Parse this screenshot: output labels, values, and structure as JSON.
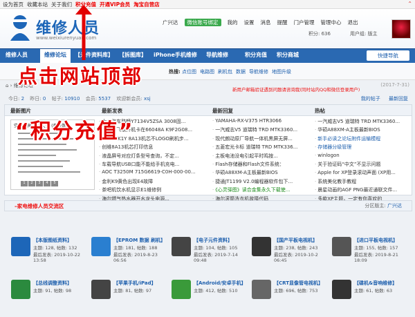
{
  "topbar": {
    "links": [
      "设为首页",
      "收藏本站",
      "关于我们",
      "积分充值",
      "开通VIP会员",
      "淘宝自营店"
    ],
    "red_links": [
      false,
      false,
      false,
      true,
      true,
      true
    ]
  },
  "header": {
    "logo_title": "维修人员",
    "logo_url": "www.weixiurenyuan.com",
    "user_links": [
      "广兴达",
      "微信账号绑定",
      "我的",
      "设置",
      "消息",
      "提醒",
      "门户管理",
      "管理中心",
      "退出"
    ],
    "points": "积分: 636",
    "group": "用户组: 版主"
  },
  "nav": {
    "items": [
      "维修人员",
      "维修论坛",
      "【元件资料库】",
      "【拆图库】",
      "iPhone手机维修",
      "导航维修",
      "积分充值",
      "积分商城"
    ],
    "active_index": 1,
    "quick": "快捷导航"
  },
  "hot": {
    "label": "热搜:",
    "items": [
      "点位图",
      "电路图",
      "刷机包",
      "数据",
      "导航维修",
      "地图升级"
    ]
  },
  "overlays": {
    "line1": "点击网站顶部",
    "line2": "“积分充值”"
  },
  "breadcrumb": {
    "path": "维修论坛",
    "date": "(2017-7-31)",
    "notice": "新用户邮箱验证遇到问题请咨询我(同时站内QQ和微信登录用户)"
  },
  "stats": {
    "prefix": "今日:",
    "today": "2",
    "yesterday_label": "昨日:",
    "yesterday": "0",
    "threads_label": "帖子:",
    "threads": "10910",
    "members_label": "会员:",
    "members": "5537",
    "new_member_label": "欢迎新会员:",
    "new_member": "xsj",
    "links": [
      "我的帖子",
      "最新回复"
    ]
  },
  "panel": {
    "heads": [
      "最新图片",
      "最新发表",
      "最新回复",
      "热帖"
    ],
    "thumb_title": "空调故障代码大全 (奥克斯)",
    "thumb_pages": [
      "1",
      "2",
      "3",
      "4",
      "5"
    ],
    "col2": [
      "大众汽车路畅Y7134V5ZSA 3008固...",
      "汉兰达飞歌开机卡在66048A K9F2G08...",
      "创维42K1Y 8A13机芯不LOGO刷机步...",
      "创维8A13机芯打印信息",
      "液晶屏号对应灯条型号查询，不定...",
      "车载导航USB口能不能给手机充电...",
      "AOC T3250M 715G6619-C0H-000-00...",
      "金利K9黄色出现E4故障",
      "茶吧机饮水机显示E1维修例",
      "海尔燃气热水器开水龙头电源..."
    ],
    "col3": [
      "YAMAHA-RX-V375 HTR3066",
      "一汽威志V5 道瑞特 TRD MTK3360...",
      "现代朗动原厂导航一体机黑屏无屏...",
      "五菱宏光卡标 道瑞特 TRD MTK336...",
      "主板电池没电引起平时鸣按...",
      "Flash存储器和Flash文件系统：",
      "华硕A88XM-A主板最新BIOS",
      "捷通JT1199 V2.0编程器软件包下...",
      "《心灵驿图》读合金集永久下载使...",
      "海尔滚筒洗衣机故障代码"
    ],
    "col4": [
      "一汽威志V5 道瑞特 TRD MTK3360...",
      "华硕A88XM-A主板最新BIOS",
      "新手必读之论坛附件运输模程",
      "存储器分级管理",
      "winlogon",
      "关于验证码“中文”不显示问题",
      "Apple for XP登录滚动声面 (XP用...",
      "系统美化教手教程",
      "晨星动画的AGF PNG最近通联文件...",
      "多款XP主题，一定有你喜欢的"
    ],
    "col3_hl": [
      false,
      false,
      false,
      false,
      false,
      false,
      false,
      false,
      true,
      false
    ],
    "col4_hl": [
      false,
      false,
      true,
      true,
      false,
      false,
      false,
      false,
      false,
      false
    ]
  },
  "section": {
    "title": "家电维修人员交流区",
    "mod_label": "分区版主:",
    "mod": "广兴达"
  },
  "forums": [
    {
      "name": "【本版图纸资料】",
      "stats": "主题: 128, 帖数: 132",
      "last": "最后发表: 2019-10-22",
      "time": "13:58"
    },
    {
      "name": "【EPROM 数据 刷机】",
      "stats": "主题: 181, 帖数: 188",
      "last": "最后发表: 2019-8-23",
      "time": "06:56"
    },
    {
      "name": "【电子元件资料】",
      "stats": "主题: 104, 帖数: 105",
      "last": "最后发表: 2019-7-14",
      "time": "09:48"
    },
    {
      "name": "【国产平板电视机】",
      "stats": "主题: 238, 帖数: 243",
      "last": "最后发表: 2019-10-2",
      "time": "06:45"
    },
    {
      "name": "【进口平板电视机】",
      "stats": "主题: 155, 帖数: 157",
      "last": "最后发表: 2019-8-21",
      "time": "18:09"
    },
    {
      "name": "【总线调整资料】",
      "stats": "主题: 91, 帖数: 98",
      "last": "",
      "time": ""
    },
    {
      "name": "【苹果手机/iPad】",
      "stats": "主题: 81, 帖数: 97",
      "last": "",
      "time": ""
    },
    {
      "name": "【Android/安卓手机】",
      "stats": "主题: 412, 帖数: 510",
      "last": "",
      "time": ""
    },
    {
      "name": "【CRT显像管电视机】",
      "stats": "主题: 696, 帖数: 753",
      "last": "",
      "time": ""
    },
    {
      "name": "【碟机&音响维修】",
      "stats": "主题: 61, 帖数: 63",
      "last": "",
      "time": ""
    }
  ],
  "colors": {
    "brand": "#2a69b2",
    "accent_red": "#e20000"
  }
}
